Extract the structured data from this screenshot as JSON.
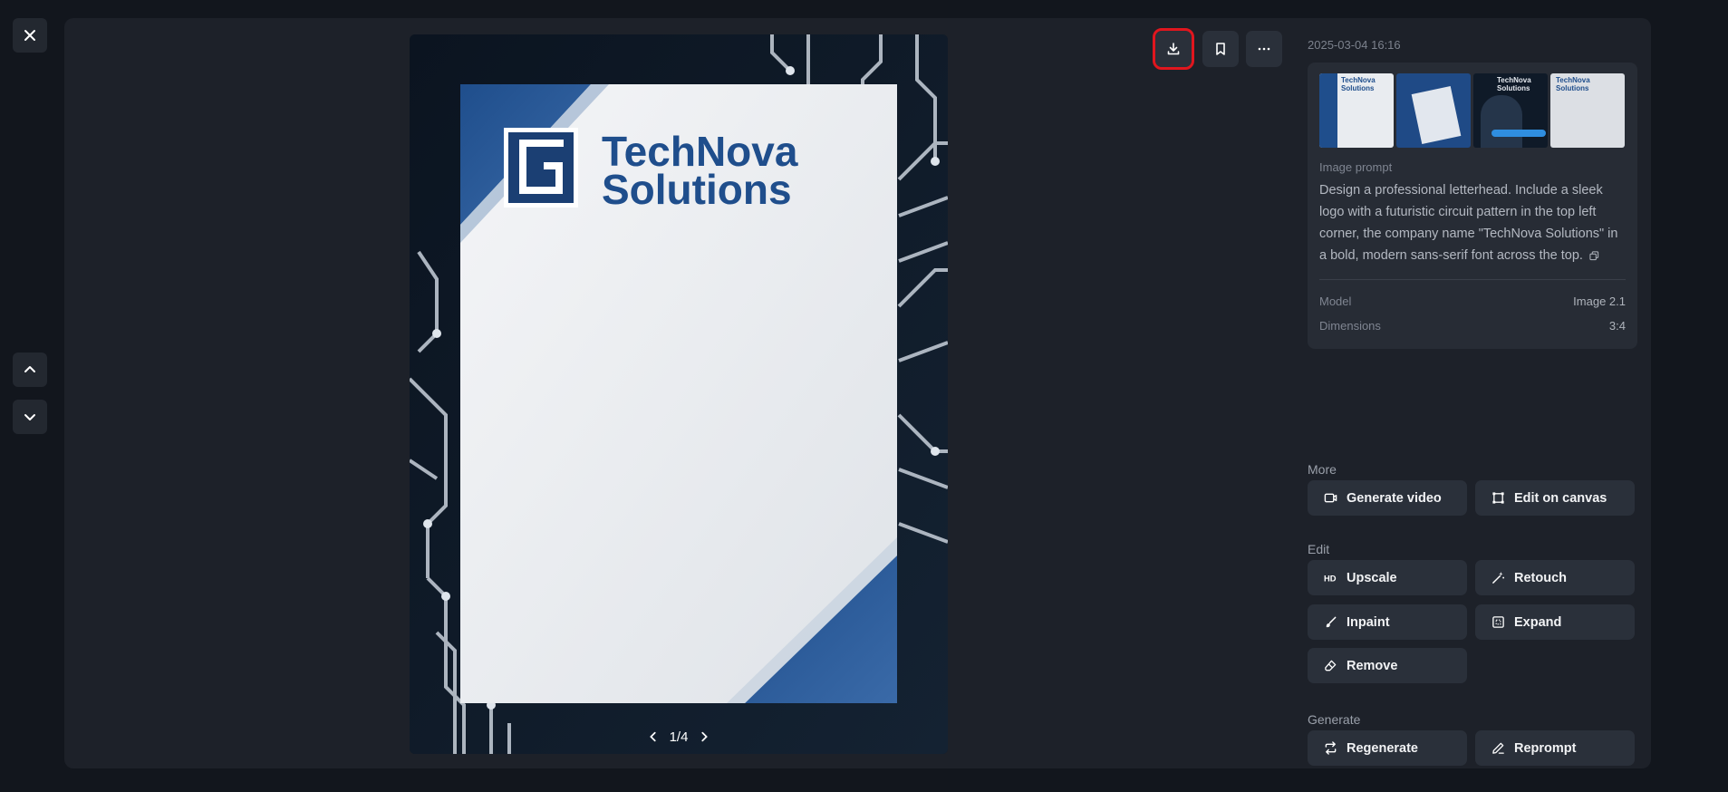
{
  "nav": {
    "close": "close-icon",
    "prev": "chevron-up-icon",
    "next": "chevron-down-icon"
  },
  "toolbar": {
    "download": "download-icon",
    "bookmark": "bookmark-icon",
    "more": "more-icon"
  },
  "image": {
    "logo_line1": "TechNova",
    "logo_line2": "Solutions",
    "pager": "1/4",
    "pager_prev": "chevron-left-icon",
    "pager_next": "chevron-right-icon",
    "accent": "#1f4e8c"
  },
  "details": {
    "timestamp": "2025-03-04 16:16",
    "thumbnails": [
      {
        "label": "TechNova Solutions"
      },
      {
        "label": ""
      },
      {
        "label": "TechNova Solutions"
      },
      {
        "label": "TechNova Solutions"
      }
    ],
    "prompt_label": "Image prompt",
    "prompt_text": "Design a professional letterhead. Include a sleek logo with a futuristic circuit pattern in the top left corner, the company name \"TechNova Solutions\" in a bold, modern sans-serif font across the top.",
    "meta": [
      {
        "key": "Model",
        "value": "Image 2.1"
      },
      {
        "key": "Dimensions",
        "value": "3:4"
      }
    ]
  },
  "actions": {
    "more_title": "More",
    "generate_video": "Generate video",
    "edit_on_canvas": "Edit on canvas",
    "edit_title": "Edit",
    "upscale": "Upscale",
    "retouch": "Retouch",
    "inpaint": "Inpaint",
    "expand": "Expand",
    "remove": "Remove",
    "generate_title": "Generate",
    "regenerate": "Regenerate",
    "reprompt": "Reprompt"
  }
}
